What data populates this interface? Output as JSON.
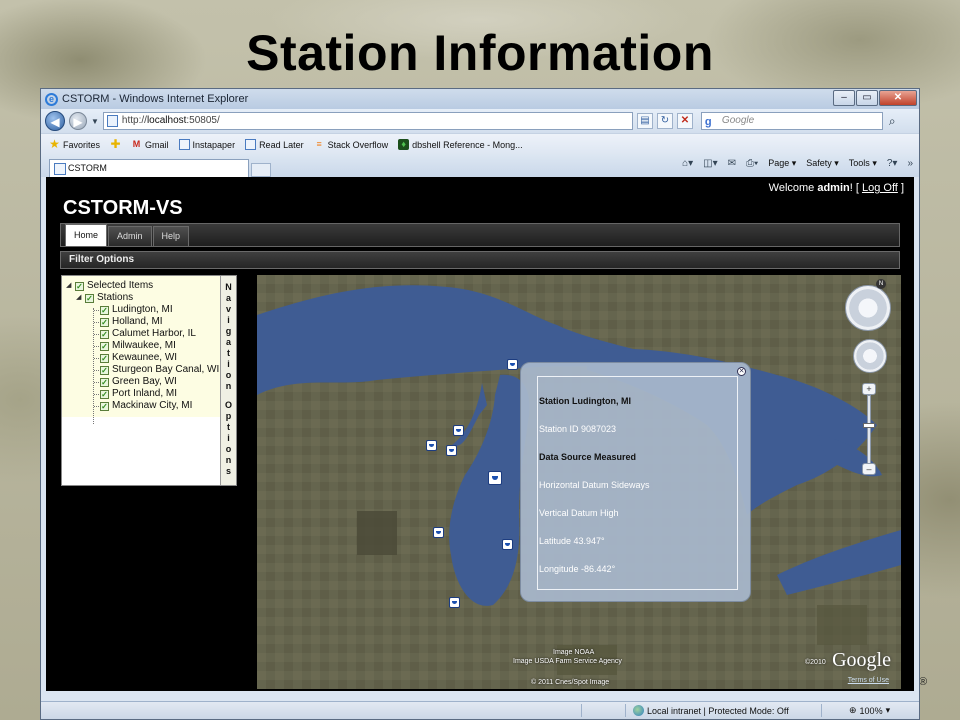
{
  "slide": {
    "title": "Station Information",
    "copyright_mark": "®"
  },
  "window": {
    "title": "CSTORM - Windows Internet Explorer"
  },
  "addressbar": {
    "url_prefix": "http://",
    "url_host": "localhost",
    "url_suffix": ":50805/",
    "search_placeholder": "Google"
  },
  "favorites_bar": {
    "favorites_label": "Favorites",
    "items": [
      "Gmail",
      "Instapaper",
      "Read Later",
      "Stack Overflow",
      "dbshell Reference - Mong..."
    ]
  },
  "tabs": [
    {
      "label": "CSTORM"
    }
  ],
  "command_bar": {
    "page": "Page",
    "safety": "Safety",
    "tools": "Tools"
  },
  "app": {
    "welcome_prefix": "Welcome ",
    "user": "admin",
    "welcome_suffix": "! [",
    "logoff": "Log Off",
    "welcome_end": "]",
    "title": "CSTORM-VS",
    "nav_tabs": [
      "Home",
      "Admin",
      "Help"
    ],
    "active_tab": "Home",
    "filter_options": "Filter Options"
  },
  "tree": {
    "root": "Selected Items",
    "group": "Stations",
    "stations": [
      "Ludington, MI",
      "Holland, MI",
      "Calumet Harbor, IL",
      "Milwaukee, MI",
      "Kewaunee, WI",
      "Sturgeon Bay Canal, WI",
      "Green Bay, WI",
      "Port Inland, MI",
      "Mackinaw City, MI"
    ],
    "side_label_1": [
      "N",
      "a",
      "v",
      "i",
      "g",
      "a",
      "t",
      "i",
      "o",
      "n"
    ],
    "side_label_2": [
      "O",
      "p",
      "t",
      "i",
      "o",
      "n",
      "s"
    ]
  },
  "balloon": {
    "title": "Station Ludington, MI",
    "station_id": "Station ID 9087023",
    "data_source": "Data Source Measured",
    "horizontal_datum": "Horizontal Datum Sideways",
    "vertical_datum": "Vertical Datum High",
    "latitude": "Latitude 43.947°",
    "longitude": "Longitude -86.442°"
  },
  "map": {
    "credit_1": "Image NOAA",
    "credit_2": "Image USDA Farm Service Agency",
    "credit_3": "© 2011 Cnes/Spot Image",
    "year": "©2010",
    "logo": "Google",
    "terms": "Terms of Use",
    "compass_n": "N"
  },
  "statusbar": {
    "zone": "Local intranet | Protected Mode: Off",
    "zoom": "100%"
  },
  "colors": {
    "page_bg": "#000000",
    "water": "#3f5c93",
    "land": "#6b6a52",
    "balloon": "#a8b8cc",
    "check": "#2f8a1e"
  }
}
